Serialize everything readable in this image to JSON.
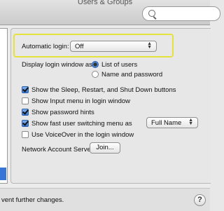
{
  "window": {
    "title": "Users & Groups"
  },
  "search": {
    "placeholder": ""
  },
  "login": {
    "auto_login_label": "Automatic login:",
    "auto_login_value": "Off",
    "display_label": "Display login window as:",
    "display_options": [
      {
        "label": "List of users",
        "selected": true
      },
      {
        "label": "Name and password",
        "selected": false
      }
    ],
    "checkboxes": [
      {
        "label": "Show the Sleep, Restart, and Shut Down buttons",
        "checked": true
      },
      {
        "label": "Show Input menu in login window",
        "checked": false
      },
      {
        "label": "Show password hints",
        "checked": true
      },
      {
        "label": "Show fast user switching menu as",
        "checked": true
      },
      {
        "label": "Use VoiceOver in the login window",
        "checked": false
      }
    ],
    "fast_switch_value": "Full Name",
    "network_label": "Network Account Server:",
    "join_button": "Join..."
  },
  "footer": {
    "lock_text": "vent further changes.",
    "help_label": "?"
  },
  "colors": {
    "highlight": "#e6e23c",
    "selection": "#3876d6"
  }
}
